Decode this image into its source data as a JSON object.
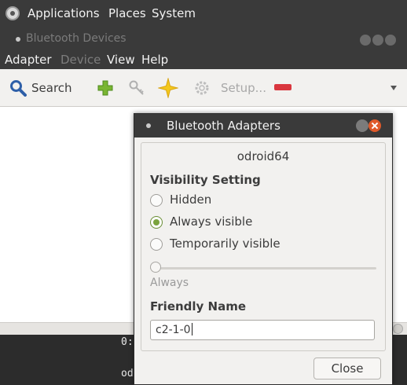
{
  "top_panel": {
    "items": [
      "Applications",
      "Places",
      "System"
    ]
  },
  "bluetooth_window": {
    "title": "Bluetooth Devices",
    "menus": [
      {
        "label": "Adapter",
        "enabled": true
      },
      {
        "label": "Device",
        "enabled": false
      },
      {
        "label": "View",
        "enabled": true
      },
      {
        "label": "Help",
        "enabled": true
      }
    ],
    "toolbar": {
      "search_label": "Search",
      "setup_label": "Setup..."
    }
  },
  "terminal": {
    "line1": "0:",
    "line2": "od"
  },
  "dialog": {
    "title": "Bluetooth Adapters",
    "adapter_name": "odroid64",
    "visibility_heading": "Visibility Setting",
    "visibility_options": [
      {
        "label": "Hidden",
        "selected": false
      },
      {
        "label": "Always visible",
        "selected": true
      },
      {
        "label": "Temporarily visible",
        "selected": false
      }
    ],
    "timeout_caption": "Always",
    "friendly_name_heading": "Friendly Name",
    "friendly_name_value": "c2-1-0",
    "close_label": "Close"
  },
  "colors": {
    "panel_bg": "#3a3a3a",
    "window_bg": "#f2f1ef",
    "close_button": "#e05a2a",
    "radio_checked": "#7aa33d"
  },
  "icons": [
    "applications-logo-icon",
    "search-icon",
    "add-icon",
    "key-icon",
    "star-icon",
    "gear-icon",
    "remove-icon",
    "dropdown-arrow-icon"
  ]
}
